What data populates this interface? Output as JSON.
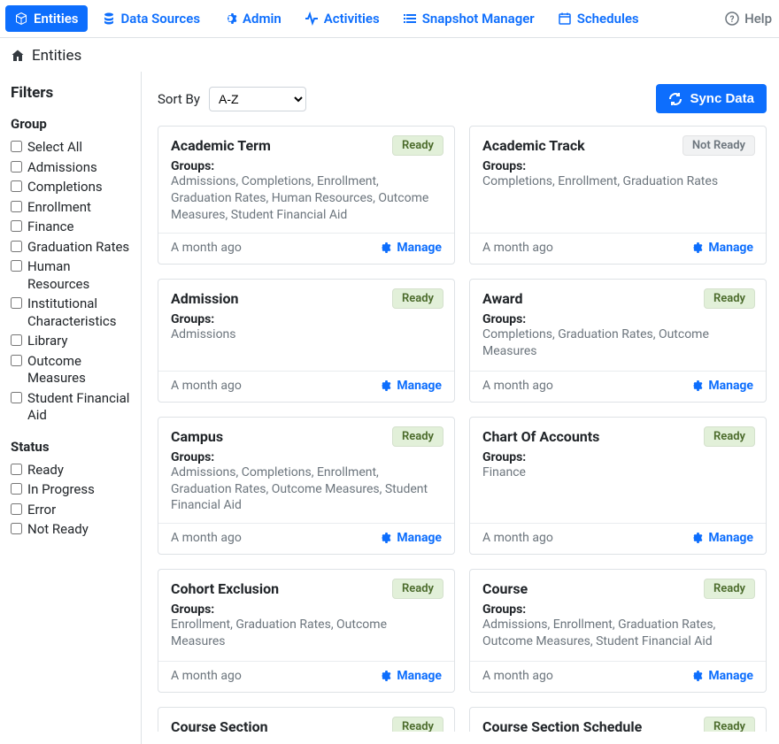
{
  "nav": {
    "items": [
      {
        "id": "entities",
        "label": "Entities",
        "icon": "cube",
        "active": true
      },
      {
        "id": "data-sources",
        "label": "Data Sources",
        "icon": "stack",
        "active": false
      },
      {
        "id": "admin",
        "label": "Admin",
        "icon": "gear",
        "active": false
      },
      {
        "id": "activities",
        "label": "Activities",
        "icon": "pulse",
        "active": false
      },
      {
        "id": "snapshot-manager",
        "label": "Snapshot Manager",
        "icon": "list",
        "active": false
      },
      {
        "id": "schedules",
        "label": "Schedules",
        "icon": "calendar",
        "active": false
      }
    ],
    "help_label": "Help"
  },
  "breadcrumb": {
    "label": "Entities"
  },
  "filters": {
    "title": "Filters",
    "group_title": "Group",
    "group_items": [
      "Select All",
      "Admissions",
      "Completions",
      "Enrollment",
      "Finance",
      "Graduation Rates",
      "Human Resources",
      "Institutional Characteristics",
      "Library",
      "Outcome Measures",
      "Student Financial Aid"
    ],
    "status_title": "Status",
    "status_items": [
      "Ready",
      "In Progress",
      "Error",
      "Not Ready"
    ]
  },
  "sort": {
    "label": "Sort By",
    "selected": "A-Z"
  },
  "sync_label": "Sync Data",
  "groups_label": "Groups:",
  "manage_label": "Manage",
  "entities": [
    {
      "title": "Academic Term",
      "status": "Ready",
      "groups": "Admissions, Completions, Enrollment, Graduation Rates, Human Resources, Outcome Measures, Student Financial Aid",
      "ts": "A month ago"
    },
    {
      "title": "Academic Track",
      "status": "Not Ready",
      "groups": "Completions, Enrollment, Graduation Rates",
      "ts": "A month ago"
    },
    {
      "title": "Admission",
      "status": "Ready",
      "groups": "Admissions",
      "ts": "A month ago"
    },
    {
      "title": "Award",
      "status": "Ready",
      "groups": "Completions, Graduation Rates, Outcome Measures",
      "ts": "A month ago"
    },
    {
      "title": "Campus",
      "status": "Ready",
      "groups": "Admissions, Completions, Enrollment, Graduation Rates, Outcome Measures, Student Financial Aid",
      "ts": "A month ago"
    },
    {
      "title": "Chart Of Accounts",
      "status": "Ready",
      "groups": "Finance",
      "ts": "A month ago"
    },
    {
      "title": "Cohort Exclusion",
      "status": "Ready",
      "groups": "Enrollment, Graduation Rates, Outcome Measures",
      "ts": "A month ago"
    },
    {
      "title": "Course",
      "status": "Ready",
      "groups": "Admissions, Enrollment, Graduation Rates, Outcome Measures, Student Financial Aid",
      "ts": "A month ago"
    },
    {
      "title": "Course Section",
      "status": "Ready",
      "groups": "",
      "ts": ""
    },
    {
      "title": "Course Section Schedule",
      "status": "Ready",
      "groups": "",
      "ts": ""
    }
  ]
}
